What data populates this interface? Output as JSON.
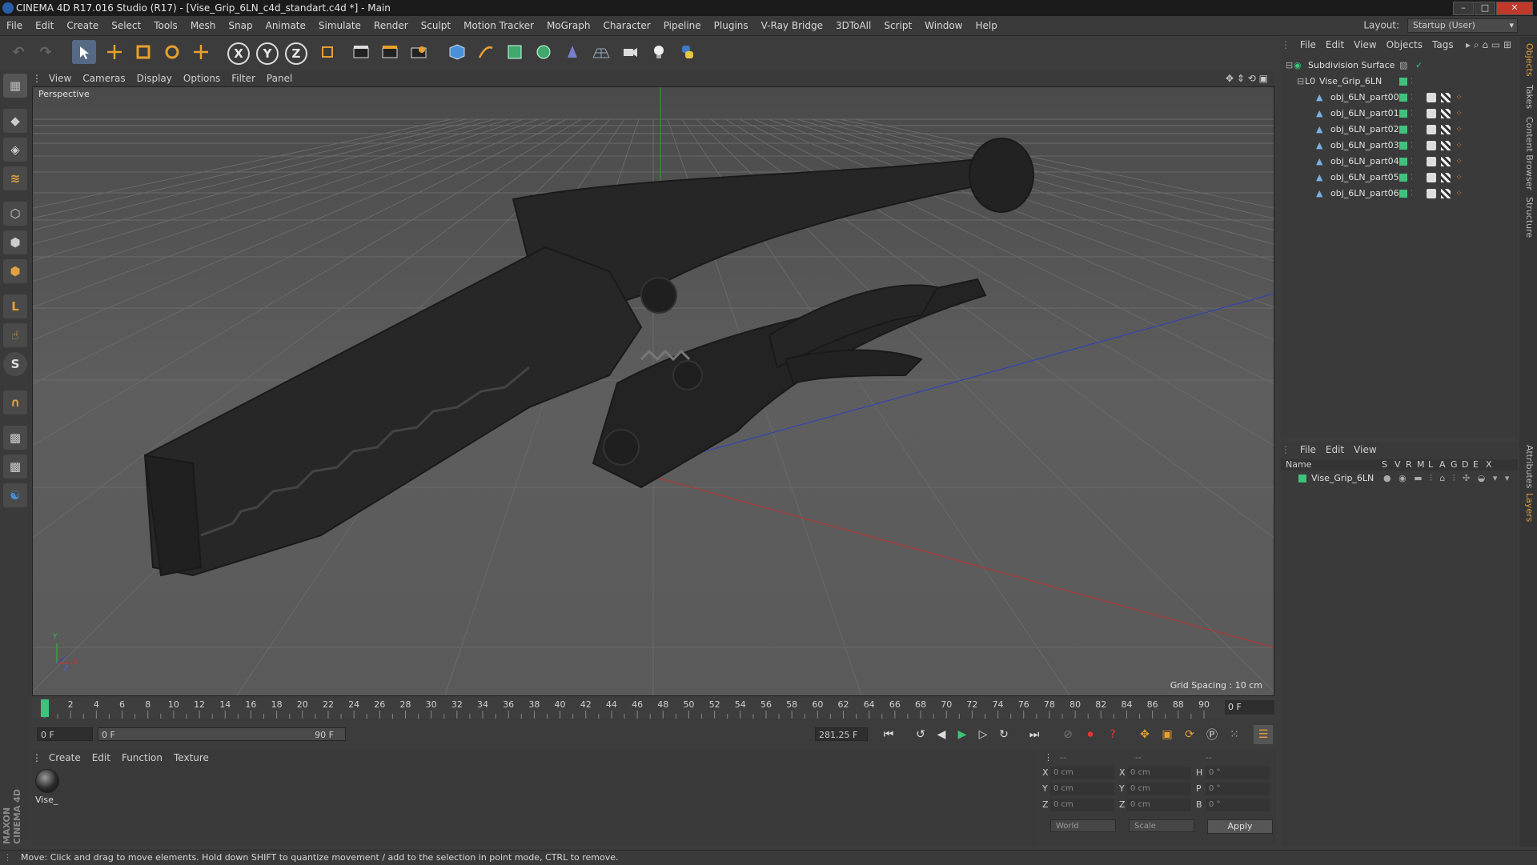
{
  "window": {
    "title": "CINEMA 4D R17.016 Studio (R17) - [Vise_Grip_6LN_c4d_standart.c4d *] - Main",
    "minimize": "–",
    "maximize": "□",
    "close": "✕"
  },
  "menubar": {
    "items": [
      "File",
      "Edit",
      "Create",
      "Select",
      "Tools",
      "Mesh",
      "Snap",
      "Animate",
      "Simulate",
      "Render",
      "Sculpt",
      "Motion Tracker",
      "MoGraph",
      "Character",
      "Pipeline",
      "Plugins",
      "V-Ray Bridge",
      "3DToAll",
      "Script",
      "Window",
      "Help"
    ],
    "layout_label": "Layout:",
    "layout_value": "Startup (User)"
  },
  "toolbar": {
    "x_axis": "X",
    "y_axis": "Y",
    "z_axis": "Z"
  },
  "left_toolbar": {
    "maxon_text": "MAXON CINEMA 4D"
  },
  "viewport": {
    "menu": [
      "View",
      "Cameras",
      "Display",
      "Options",
      "Filter",
      "Panel"
    ],
    "label": "Perspective",
    "grid_spacing": "Grid Spacing : 10 cm",
    "axis_y": "Y",
    "axis_x": "X",
    "axis_z": "Z"
  },
  "timeline": {
    "ticks": [
      0,
      2,
      4,
      6,
      8,
      10,
      12,
      14,
      16,
      18,
      20,
      22,
      24,
      26,
      28,
      30,
      32,
      34,
      36,
      38,
      40,
      42,
      44,
      46,
      48,
      50,
      52,
      54,
      56,
      58,
      60,
      62,
      64,
      66,
      68,
      70,
      72,
      74,
      76,
      78,
      80,
      82,
      84,
      86,
      88,
      90
    ],
    "current_frame": 0,
    "end_field": "0 F"
  },
  "transport": {
    "start_field": "0 F",
    "range_start": "0 F",
    "range_end": "90 F",
    "fps_field": "281.25 F"
  },
  "materials": {
    "menu": [
      "Create",
      "Edit",
      "Function",
      "Texture"
    ],
    "items": [
      {
        "name": "Vise_"
      }
    ]
  },
  "coordinates": {
    "header": [
      "--",
      "--",
      "--"
    ],
    "rows": [
      {
        "axis": "X",
        "pos": "0 cm",
        "axis2": "X",
        "size": "0 cm",
        "rot_label": "H",
        "rot": "0 °"
      },
      {
        "axis": "Y",
        "pos": "0 cm",
        "axis2": "Y",
        "size": "0 cm",
        "rot_label": "P",
        "rot": "0 °"
      },
      {
        "axis": "Z",
        "pos": "0 cm",
        "axis2": "Z",
        "size": "0 cm",
        "rot_label": "B",
        "rot": "0 °"
      }
    ],
    "mode_world": "World",
    "mode_scale": "Scale",
    "apply": "Apply"
  },
  "status": "Move: Click and drag to move elements. Hold down SHIFT to quantize movement / add to the selection in point mode, CTRL to remove.",
  "objects": {
    "menu": [
      "File",
      "Edit",
      "View",
      "Objects",
      "Tags"
    ],
    "tree": [
      {
        "name": "Subdivision Surface",
        "level": 0
      },
      {
        "name": "Vise_Grip_6LN",
        "level": 1
      },
      {
        "name": "obj_6LN_part00",
        "level": 2
      },
      {
        "name": "obj_6LN_part01",
        "level": 2
      },
      {
        "name": "obj_6LN_part02",
        "level": 2
      },
      {
        "name": "obj_6LN_part03",
        "level": 2
      },
      {
        "name": "obj_6LN_part04",
        "level": 2
      },
      {
        "name": "obj_6LN_part05",
        "level": 2
      },
      {
        "name": "obj_6LN_part06",
        "level": 2
      }
    ]
  },
  "layers": {
    "menu": [
      "File",
      "Edit",
      "View"
    ],
    "columns": [
      "Name",
      "S",
      "V",
      "R",
      "M",
      "L",
      "A",
      "G",
      "D",
      "E",
      "X"
    ],
    "rows": [
      {
        "name": "Vise_Grip_6LN"
      }
    ]
  },
  "right_tabs": [
    "Objects",
    "Takes",
    "Content Browser",
    "Structure",
    "Attributes",
    "Layers"
  ],
  "colors": {
    "accent_green": "#3fc27b",
    "x_axis": "#d03030",
    "y_axis": "#30c030",
    "z_axis": "#3040d0"
  }
}
